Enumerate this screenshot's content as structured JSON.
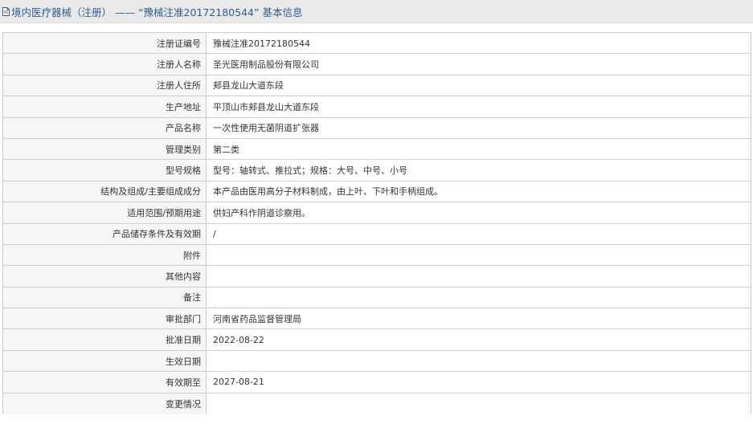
{
  "header": {
    "category": "境内医疗器械（注册）",
    "separator": "——",
    "registration_title": "“豫械注准20172180544”",
    "suffix": "基本信息",
    "icon": "document-icon",
    "accent_color": "#2f5d91"
  },
  "rows": [
    {
      "label": "注册证编号",
      "value": "豫械注准20172180544"
    },
    {
      "label": "注册人名称",
      "value": "圣光医用制品股份有限公司"
    },
    {
      "label": "注册人住所",
      "value": "郏县龙山大道东段"
    },
    {
      "label": "生产地址",
      "value": "平顶山市郏县龙山大道东段"
    },
    {
      "label": "产品名称",
      "value": "一次性使用无菌阴道扩张器"
    },
    {
      "label": "管理类别",
      "value": "第二类"
    },
    {
      "label": "型号规格",
      "value": "型号：轴转式、推拉式；规格：大号、中号、小号"
    },
    {
      "label": "结构及组成/主要组成成分",
      "value": "本产品由医用高分子材料制成，由上叶、下叶和手柄组成。"
    },
    {
      "label": "适用范围/预期用途",
      "value": "供妇产科作阴道诊察用。"
    },
    {
      "label": "产品储存条件及有效期",
      "value": "/"
    },
    {
      "label": "附件",
      "value": ""
    },
    {
      "label": "其他内容",
      "value": ""
    },
    {
      "label": "备注",
      "value": ""
    },
    {
      "label": "审批部门",
      "value": "河南省药品监督管理局"
    },
    {
      "label": "批准日期",
      "value": "2022-08-22"
    },
    {
      "label": "生效日期",
      "value": ""
    },
    {
      "label": "有效期至",
      "value": "2027-08-21"
    },
    {
      "label": "变更情况",
      "value": ""
    }
  ]
}
